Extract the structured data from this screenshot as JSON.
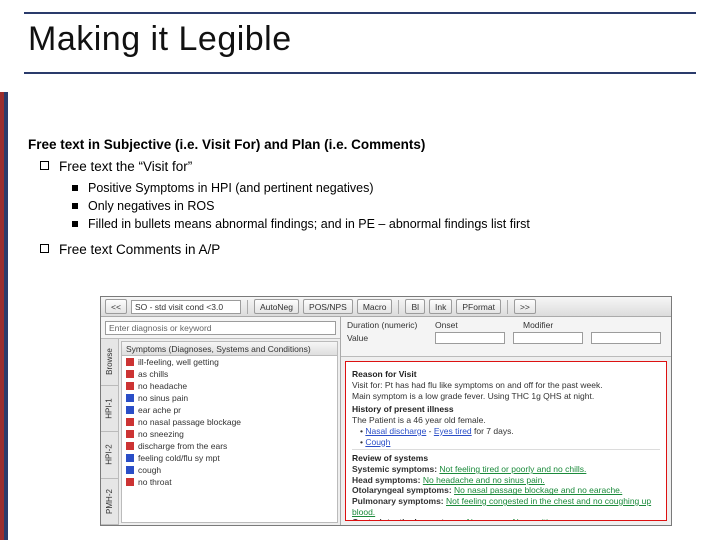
{
  "slide": {
    "title": "Making it Legible",
    "heading": "Free text in Subjective (i.e. Visit For) and Plan (i.e. Comments)",
    "bullets1": [
      "Free text the “Visit for”"
    ],
    "sub_bullets": [
      "Positive Symptoms in HPI (and pertinent negatives)",
      "Only negatives in ROS",
      "Filled in bullets means abnormal findings; and in PE – abnormal findings list first"
    ],
    "bullets2": [
      "Free text Comments in A/P"
    ]
  },
  "shot": {
    "toolbar": {
      "back": "<<",
      "combo": "SO - std visit cond <3.0",
      "items": [
        "AutoNeg",
        "POS/NPS",
        "Macro",
        "Bl",
        "Ink",
        "PFormat",
        ">>"
      ]
    },
    "leftcol": {
      "search_placeholder": "Enter diagnosis or keyword",
      "vtabs": [
        "Browse",
        "HPI-1",
        "HPI-2",
        "PMH-2"
      ],
      "list_header": "Symptoms (Diagnoses, Systems and Conditions)",
      "items": [
        {
          "flag": "red",
          "txt": "ill-feeling, well getting"
        },
        {
          "flag": "red",
          "txt": "as chills"
        },
        {
          "flag": "red",
          "txt": "no headache"
        },
        {
          "flag": "blue",
          "txt": "no sinus pain"
        },
        {
          "flag": "blue",
          "txt": "ear ache pr"
        },
        {
          "flag": "red",
          "txt": "no nasal passage blockage"
        },
        {
          "flag": "red",
          "txt": "no sneezing"
        },
        {
          "flag": "red",
          "txt": "discharge from the ears"
        },
        {
          "flag": "blue",
          "txt": "feeling cold/flu sy mpt"
        },
        {
          "flag": "blue",
          "txt": "cough"
        },
        {
          "flag": "red",
          "txt": "no throat"
        }
      ]
    },
    "rightcol": {
      "top_labels": [
        "Duration (numeric)",
        "Onset",
        "Modifier",
        "Value"
      ],
      "reason_hd": "Reason for Visit",
      "reason_txt_a": "Visit for: Pt has had flu like symptoms on and off for the past week.",
      "reason_txt_b": "Main symptom is a low grade fever. Using THC 1g QHS at night.",
      "hpi_hd": "History of present illness",
      "hpi_line": "The Patient is a 46 year old female.",
      "hpi_items": [
        {
          "a": "Nasal discharge",
          "b": "Eyes tired",
          "c": "for 7 days."
        },
        {
          "a": "Cough",
          "b": "",
          "c": ""
        }
      ],
      "ros_hd": "Review of systems",
      "ros_rows": [
        {
          "label": "Systemic symptoms:",
          "val": "Not feeling tired or poorly and no chills."
        },
        {
          "label": "Head symptoms:",
          "val": "No headache and no sinus pain."
        },
        {
          "label": "Otolaryngeal symptoms:",
          "val": "No nasal passage blockage and no earache."
        },
        {
          "label": "Pulmonary symptoms:",
          "val": "Not feeling congested in the chest and no coughing up blood."
        },
        {
          "label": "Gastrointestinal symptoms:",
          "val": "No nausea. No vomiting."
        }
      ]
    }
  }
}
